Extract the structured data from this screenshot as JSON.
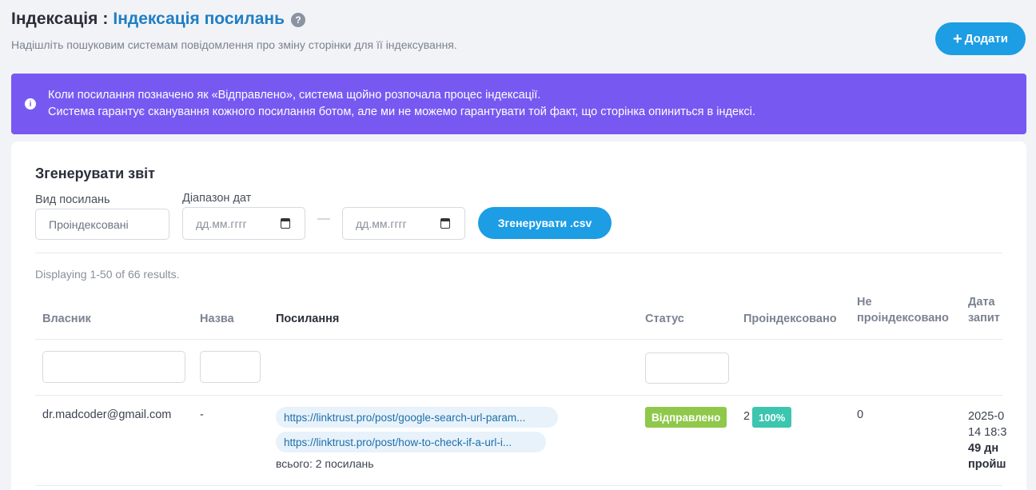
{
  "header": {
    "title_main": "Індексація",
    "title_sep": ":",
    "title_sub": "Індексація посилань",
    "help_icon": "?",
    "subtitle": "Надішліть пошуковим системам повідомлення про зміну сторінки для її індексування.",
    "add_icon": "+",
    "add_label": "Додати"
  },
  "alert": {
    "icon": "i",
    "line1": "Коли посилання позначено як «Відправлено», система щойно розпочала процес індексації.",
    "line2": "Система гарантує сканування кожного посилання ботом, але ми не можемо гарантувати той факт, що сторінка опиниться в індексі."
  },
  "report": {
    "title": "Згенерувати звіт",
    "link_type_label": "Вид посилань",
    "link_type_value": "Проіндексовані",
    "date_range_label": "Діапазон дат",
    "date_from_placeholder": "дд.мм.гггг",
    "date_to_placeholder": "дд.мм.гггг",
    "dash": "—",
    "generate_label": "Згенерувати .csv"
  },
  "table": {
    "summary": "Displaying 1-50 of 66 results.",
    "columns": {
      "owner": "Власник",
      "name": "Назва",
      "links": "Посилання",
      "status": "Статус",
      "indexed": "Проіндексовано",
      "not_indexed_1": "Не",
      "not_indexed_2": "проіндексовано",
      "date_1": "Дата",
      "date_2": "запит"
    },
    "row": {
      "owner": "dr.madcoder@gmail.com",
      "name": "-",
      "link1": "https://linktrust.pro/post/google-search-url-param...",
      "link2": "https://linktrust.pro/post/how-to-check-if-a-url-i...",
      "links_total": "всього: 2 посилань",
      "status": "Відправлено",
      "indexed_count": "2",
      "indexed_pct": "100%",
      "not_indexed": "0",
      "date_1": "2025-0",
      "date_2": "14 18:3",
      "date_3": "49 дн",
      "date_4": "пройш"
    }
  },
  "colors": {
    "accent": "#1c9de4",
    "alert_bg": "#7759f2",
    "status_sent": "#8fc84a",
    "percent_badge": "#3cc6b0",
    "link_color": "#1f7fc4"
  }
}
